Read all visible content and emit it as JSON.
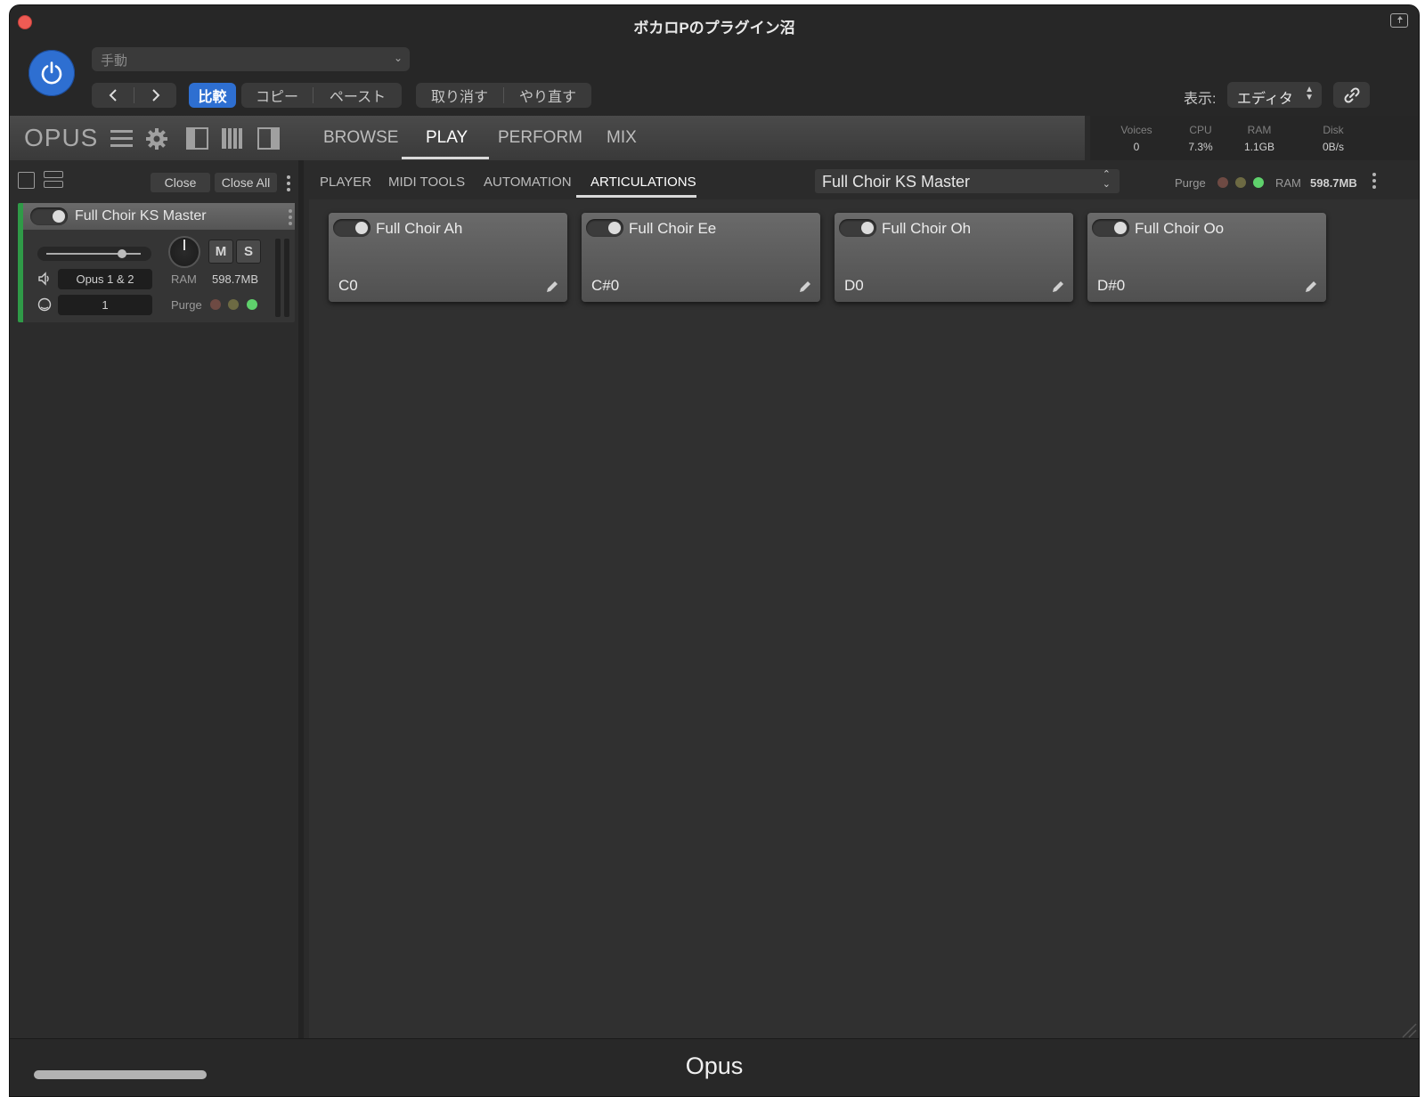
{
  "host": {
    "window_title": "ボカロPのプラグイン沼",
    "preset": "手動",
    "compare_label": "比較",
    "copy_label": "コピー",
    "paste_label": "ペースト",
    "undo_label": "取り消す",
    "redo_label": "やり直す",
    "view_label": "表示:",
    "view_value": "エディタ"
  },
  "plugin": {
    "logo": "OPUS",
    "tabs": [
      {
        "label": "BROWSE"
      },
      {
        "label": "PLAY",
        "active": true
      },
      {
        "label": "PERFORM"
      },
      {
        "label": "MIX"
      }
    ],
    "stats": [
      {
        "label": "Voices",
        "value": "0"
      },
      {
        "label": "CPU",
        "value": "7.3%"
      },
      {
        "label": "RAM",
        "value": "1.1GB"
      },
      {
        "label": "Disk",
        "value": "0B/s"
      }
    ]
  },
  "left_panel": {
    "close_label": "Close",
    "close_all_label": "Close All",
    "instrument": {
      "name": "Full Choir KS Master",
      "mute_label": "M",
      "solo_label": "S",
      "output": "Opus 1 & 2",
      "midi_channel": "1",
      "ram_label": "RAM",
      "ram_value": "598.7MB",
      "purge_label": "Purge",
      "volume_level": 0.8
    }
  },
  "sub_tabs": [
    {
      "label": "PLAYER"
    },
    {
      "label": "MIDI TOOLS"
    },
    {
      "label": "AUTOMATION"
    },
    {
      "label": "ARTICULATIONS",
      "active": true
    }
  ],
  "selected_instrument": "Full Choir KS Master",
  "purge_label": "Purge",
  "ram_label": "RAM",
  "ram_value": "598.7MB",
  "articulations": [
    {
      "name": "Full Choir Ah",
      "key": "C0"
    },
    {
      "name": "Full Choir Ee",
      "key": "C#0"
    },
    {
      "name": "Full Choir Oh",
      "key": "D0"
    },
    {
      "name": "Full Choir Oo",
      "key": "D#0"
    }
  ],
  "footer_title": "Opus",
  "colors": {
    "accent_blue": "#2e6fd1",
    "track_green": "#2f9a47",
    "close_red": "#ee5b54",
    "purge_dot_1": "#6e4a43",
    "purge_dot_2": "#6d6a43",
    "purge_dot_3": "#5fd16c"
  }
}
